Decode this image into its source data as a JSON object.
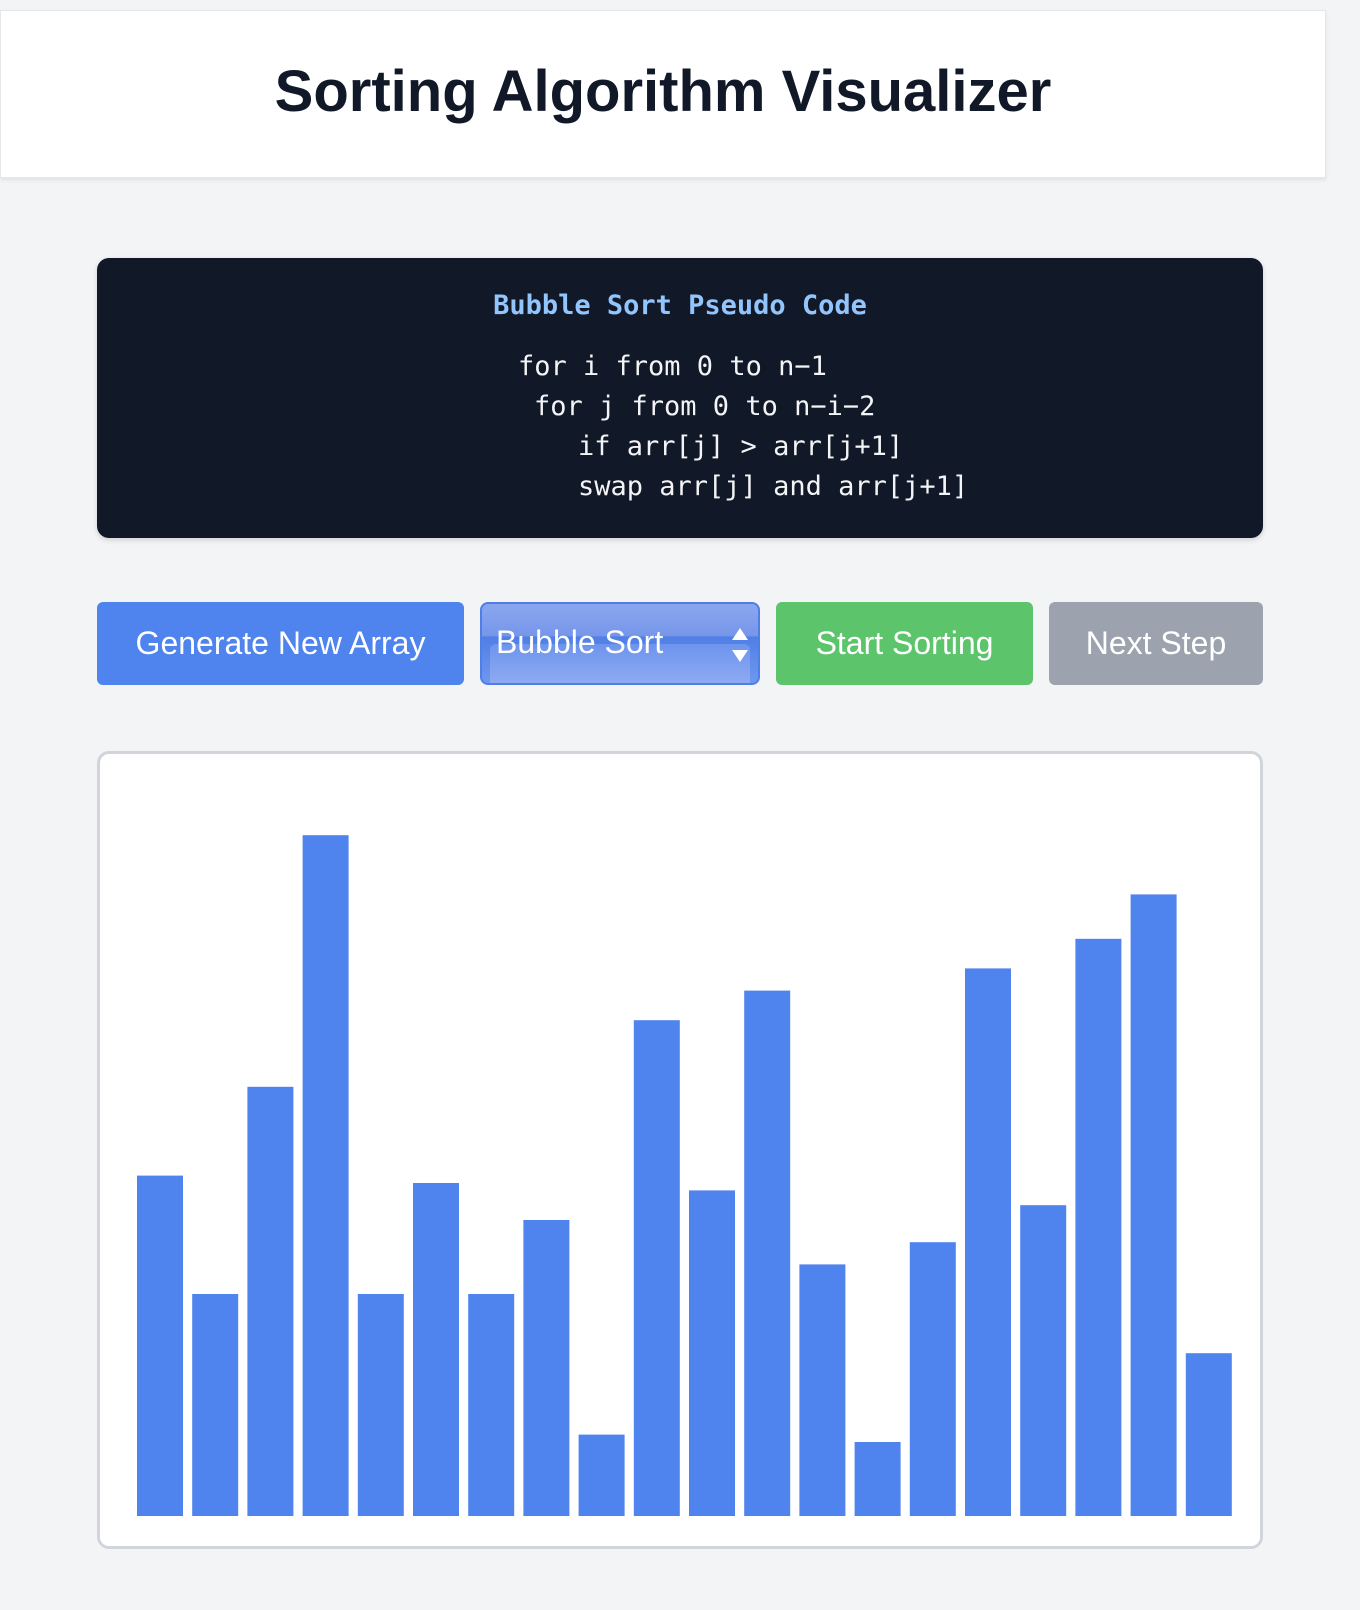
{
  "header": {
    "title": "Sorting Algorithm Visualizer"
  },
  "pseudocode": {
    "title": "Bubble Sort Pseudo Code",
    "lines": [
      "for i from 0 to n−1",
      "for j from 0 to n−i−2",
      "if arr[j] > arr[j+1]",
      "swap arr[j] and arr[j+1]"
    ]
  },
  "controls": {
    "generate_label": "Generate New Array",
    "algorithm_select": {
      "selected": "Bubble Sort"
    },
    "start_label": "Start Sorting",
    "next_label": "Next Step"
  },
  "colors": {
    "bar": "#4f83ed",
    "generate": "#4f83ed",
    "start": "#5cc46b",
    "next": "#9ca3af",
    "code_bg": "#111827",
    "code_title": "#93c5fd"
  },
  "chart_data": {
    "type": "bar",
    "values": [
      46,
      30,
      58,
      92,
      30,
      45,
      30,
      40,
      11,
      67,
      44,
      71,
      34,
      10,
      37,
      74,
      42,
      78,
      84,
      22
    ],
    "ylim": [
      0,
      100
    ]
  }
}
